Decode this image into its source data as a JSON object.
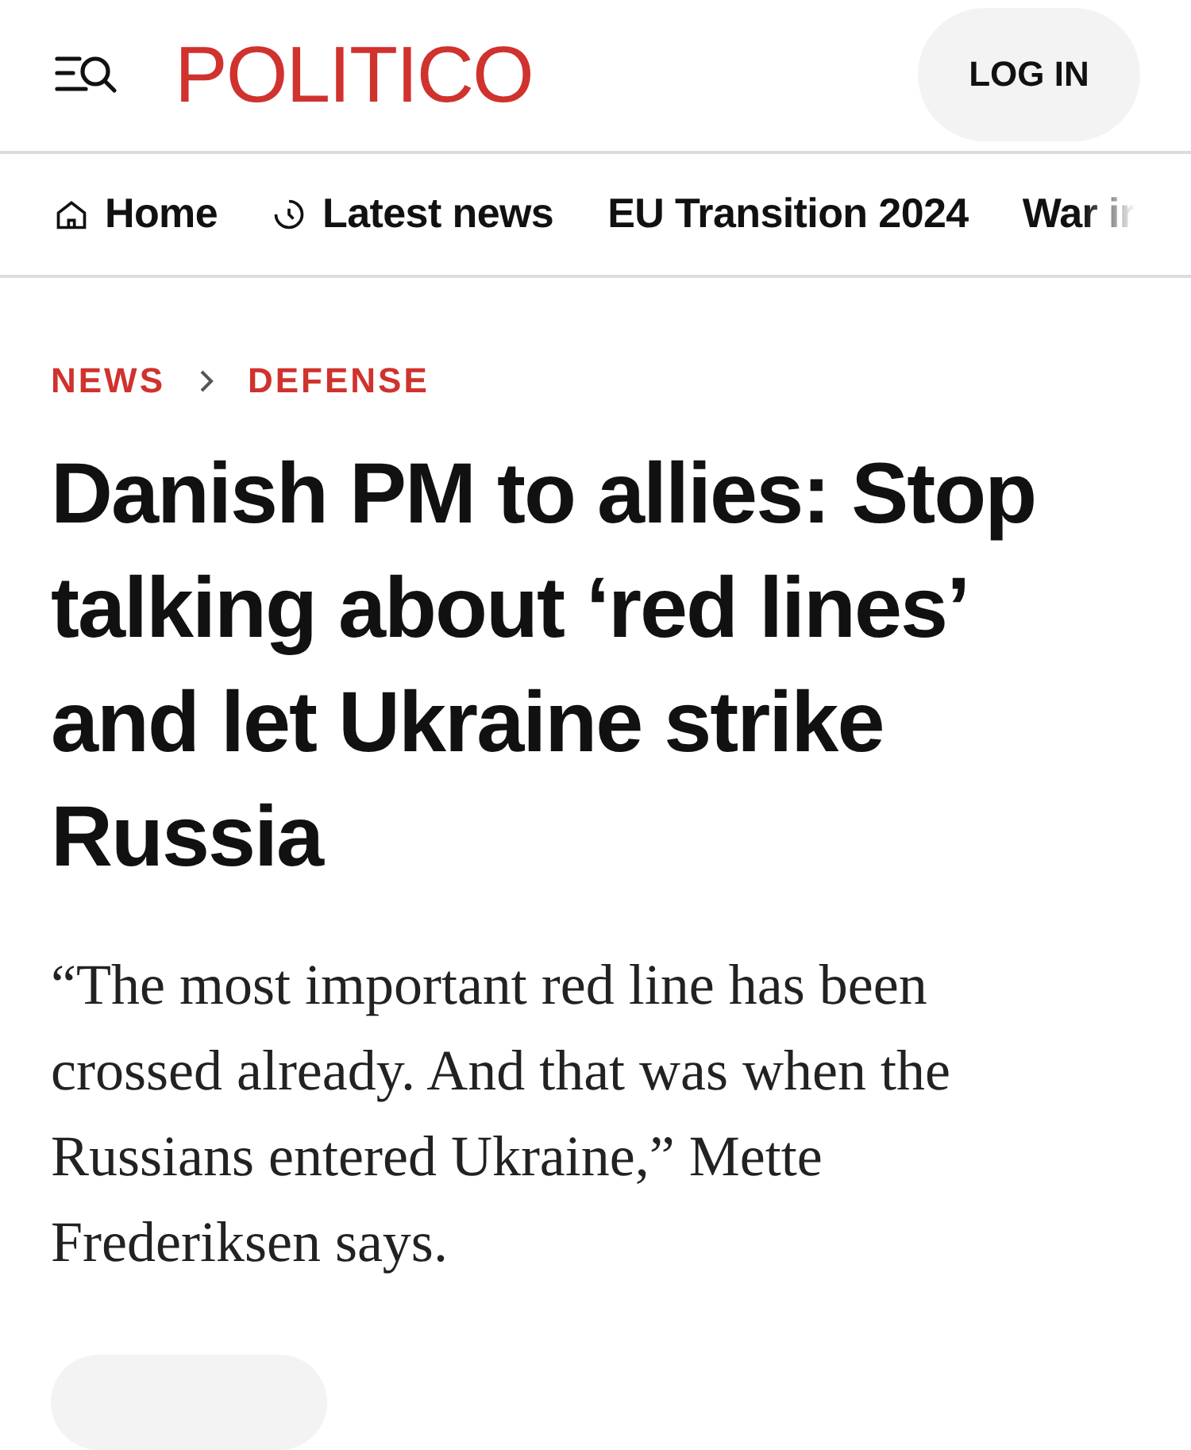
{
  "header": {
    "logo": "POLITICO",
    "login_button": "LOG IN"
  },
  "nav": [
    {
      "label": "Home",
      "kind": "home"
    },
    {
      "label": "Latest news",
      "kind": "clock"
    },
    {
      "label": "EU Transition 2024",
      "kind": "text"
    },
    {
      "label": "War ir",
      "kind": "text",
      "faded": true
    }
  ],
  "breadcrumb": [
    "NEWS",
    "DEFENSE"
  ],
  "headline": "Danish PM to allies: Stop talking about ‘red lines’ and let Ukraine strike Russia",
  "dek": "“The most important red line has been crossed already. And that was when the Russians entered Ukraine,” Mette Frederiksen says."
}
